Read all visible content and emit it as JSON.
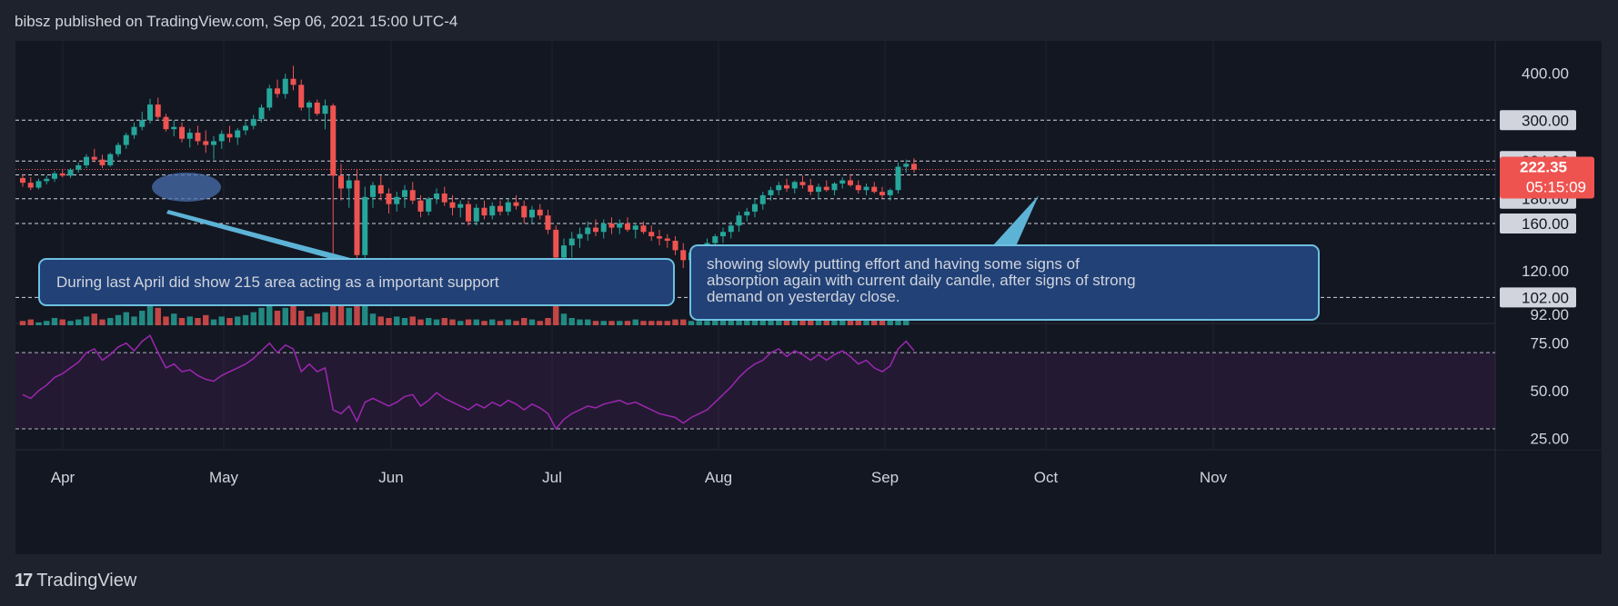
{
  "header": {
    "text": "bibsz published on TradingView.com, Sep 06, 2021 15:00 UTC-4"
  },
  "footer": {
    "brand": "TradingView",
    "logo_glyph": "17"
  },
  "colors": {
    "up": "#26a69a",
    "down": "#ef5350",
    "rsi": "#9c27b0",
    "bg": "#131722",
    "panel": "#1e222d"
  },
  "chart_data": [
    {
      "type": "candlestick",
      "scale": "log",
      "ylim": [
        90,
        460
      ],
      "x_labels": [
        "Apr",
        "May",
        "Jun",
        "Jul",
        "Aug",
        "Sep",
        "Oct",
        "Nov"
      ],
      "y_ticks": [
        {
          "label": "400.00",
          "value": 400,
          "boxed": false
        },
        {
          "label": "300.00",
          "value": 300,
          "boxed": true,
          "style": "light"
        },
        {
          "label": "234.00",
          "value": 234,
          "boxed": true,
          "style": "light"
        },
        {
          "label": "214.98",
          "value": 214.98,
          "boxed": true,
          "style": "light"
        },
        {
          "label": "186.00",
          "value": 186,
          "boxed": true,
          "style": "light"
        },
        {
          "label": "160.00",
          "value": 160,
          "boxed": true,
          "style": "light"
        },
        {
          "label": "120.00",
          "value": 120,
          "boxed": false
        },
        {
          "label": "102.00",
          "value": 102,
          "boxed": true,
          "style": "light"
        },
        {
          "label": "92.00",
          "value": 92,
          "boxed": false
        }
      ],
      "last_price": {
        "label": "222.35",
        "countdown": "05:15:09",
        "value": 222.35
      },
      "horizontal_levels": [
        300,
        234,
        222.35,
        214.98,
        186,
        160,
        102
      ],
      "candles": [
        [
          211,
          216,
          200,
          205
        ],
        [
          205,
          212,
          196,
          199
        ],
        [
          199,
          210,
          197,
          207
        ],
        [
          207,
          214,
          203,
          210
        ],
        [
          210,
          220,
          206,
          217
        ],
        [
          217,
          223,
          212,
          214
        ],
        [
          214,
          224,
          211,
          222
        ],
        [
          222,
          232,
          218,
          228
        ],
        [
          228,
          244,
          224,
          240
        ],
        [
          240,
          252,
          232,
          236
        ],
        [
          236,
          243,
          224,
          228
        ],
        [
          228,
          246,
          226,
          244
        ],
        [
          244,
          262,
          240,
          258
        ],
        [
          258,
          278,
          252,
          274
        ],
        [
          274,
          296,
          268,
          288
        ],
        [
          288,
          316,
          282,
          300
        ],
        [
          300,
          342,
          294,
          330
        ],
        [
          330,
          344,
          302,
          306
        ],
        [
          306,
          312,
          280,
          284
        ],
        [
          284,
          300,
          272,
          288
        ],
        [
          288,
          296,
          262,
          268
        ],
        [
          268,
          285,
          254,
          278
        ],
        [
          278,
          290,
          258,
          264
        ],
        [
          264,
          282,
          246,
          258
        ],
        [
          258,
          272,
          236,
          264
        ],
        [
          264,
          282,
          252,
          276
        ],
        [
          276,
          290,
          262,
          270
        ],
        [
          270,
          286,
          258,
          282
        ],
        [
          282,
          298,
          274,
          290
        ],
        [
          290,
          310,
          284,
          302
        ],
        [
          302,
          330,
          296,
          324
        ],
        [
          324,
          372,
          318,
          364
        ],
        [
          364,
          384,
          344,
          352
        ],
        [
          352,
          398,
          342,
          386
        ],
        [
          386,
          418,
          360,
          372
        ],
        [
          372,
          384,
          318,
          324
        ],
        [
          324,
          338,
          300,
          334
        ],
        [
          334,
          340,
          308,
          312
        ],
        [
          312,
          340,
          284,
          328
        ],
        [
          328,
          332,
          128,
          214
        ],
        [
          214,
          230,
          184,
          198
        ],
        [
          198,
          214,
          176,
          208
        ],
        [
          208,
          222,
          118,
          132
        ],
        [
          132,
          200,
          122,
          188
        ],
        [
          188,
          206,
          176,
          202
        ],
        [
          202,
          214,
          184,
          192
        ],
        [
          192,
          198,
          170,
          180
        ],
        [
          180,
          194,
          172,
          188
        ],
        [
          188,
          202,
          176,
          196
        ],
        [
          196,
          206,
          180,
          184
        ],
        [
          184,
          190,
          166,
          172
        ],
        [
          172,
          188,
          168,
          186
        ],
        [
          186,
          198,
          180,
          192
        ],
        [
          192,
          200,
          178,
          182
        ],
        [
          182,
          190,
          168,
          176
        ],
        [
          176,
          184,
          166,
          180
        ],
        [
          180,
          184,
          158,
          162
        ],
        [
          162,
          180,
          158,
          176
        ],
        [
          176,
          184,
          164,
          168
        ],
        [
          168,
          182,
          164,
          178
        ],
        [
          178,
          184,
          168,
          172
        ],
        [
          172,
          186,
          168,
          182
        ],
        [
          182,
          190,
          174,
          178
        ],
        [
          178,
          184,
          160,
          166
        ],
        [
          166,
          178,
          160,
          174
        ],
        [
          174,
          180,
          164,
          168
        ],
        [
          168,
          174,
          150,
          154
        ],
        [
          154,
          158,
          118,
          130
        ],
        [
          130,
          146,
          118,
          140
        ],
        [
          140,
          152,
          130,
          146
        ],
        [
          146,
          156,
          138,
          150
        ],
        [
          150,
          162,
          144,
          156
        ],
        [
          156,
          164,
          148,
          152
        ],
        [
          152,
          164,
          146,
          160
        ],
        [
          160,
          166,
          150,
          156
        ],
        [
          156,
          164,
          150,
          160
        ],
        [
          160,
          166,
          152,
          154
        ],
        [
          154,
          160,
          146,
          158
        ],
        [
          158,
          162,
          150,
          152
        ],
        [
          152,
          158,
          144,
          148
        ],
        [
          148,
          154,
          140,
          146
        ],
        [
          146,
          150,
          138,
          144
        ],
        [
          144,
          148,
          132,
          136
        ],
        [
          136,
          142,
          122,
          128
        ],
        [
          128,
          138,
          122,
          134
        ],
        [
          134,
          140,
          126,
          138
        ],
        [
          138,
          146,
          132,
          142
        ],
        [
          142,
          150,
          136,
          148
        ],
        [
          148,
          156,
          142,
          152
        ],
        [
          152,
          162,
          146,
          158
        ],
        [
          158,
          172,
          152,
          168
        ],
        [
          168,
          176,
          162,
          172
        ],
        [
          172,
          186,
          166,
          180
        ],
        [
          180,
          194,
          174,
          190
        ],
        [
          190,
          200,
          184,
          196
        ],
        [
          196,
          206,
          190,
          202
        ],
        [
          202,
          210,
          194,
          198
        ],
        [
          198,
          208,
          192,
          206
        ],
        [
          206,
          214,
          198,
          202
        ],
        [
          202,
          210,
          190,
          194
        ],
        [
          194,
          204,
          186,
          200
        ],
        [
          200,
          208,
          194,
          196
        ],
        [
          196,
          206,
          190,
          204
        ],
        [
          204,
          212,
          198,
          208
        ],
        [
          208,
          216,
          200,
          202
        ],
        [
          202,
          208,
          192,
          196
        ],
        [
          196,
          204,
          190,
          200
        ],
        [
          200,
          206,
          192,
          194
        ],
        [
          194,
          200,
          186,
          190
        ],
        [
          190,
          198,
          184,
          196
        ],
        [
          196,
          232,
          192,
          226
        ],
        [
          226,
          236,
          218,
          230
        ],
        [
          230,
          238,
          218,
          222
        ]
      ]
    },
    {
      "type": "bar",
      "name": "volume",
      "values": [
        3,
        4,
        2,
        3,
        5,
        4,
        3,
        4,
        6,
        8,
        4,
        5,
        7,
        9,
        6,
        10,
        16,
        12,
        6,
        8,
        5,
        6,
        5,
        7,
        4,
        6,
        5,
        6,
        7,
        9,
        12,
        18,
        10,
        12,
        14,
        10,
        6,
        8,
        9,
        30,
        14,
        12,
        22,
        16,
        8,
        6,
        5,
        6,
        5,
        6,
        4,
        5,
        4,
        5,
        4,
        3,
        4,
        4,
        3,
        4,
        3,
        4,
        3,
        5,
        4,
        3,
        5,
        18,
        8,
        5,
        4,
        4,
        3,
        3,
        3,
        3,
        3,
        4,
        3,
        3,
        3,
        3,
        4,
        4,
        3,
        3,
        3,
        4,
        4,
        4,
        5,
        4,
        5,
        5,
        5,
        4,
        5,
        4,
        4,
        4,
        4,
        4,
        4,
        4,
        4,
        4,
        4,
        4,
        4,
        14,
        8,
        6
      ]
    },
    {
      "type": "line",
      "name": "RSI",
      "ylim": [
        20,
        82
      ],
      "y_ticks": [
        "75.00",
        "50.00",
        "25.00"
      ],
      "band": [
        30,
        70
      ],
      "values": [
        48,
        46,
        50,
        53,
        57,
        59,
        62,
        65,
        70,
        72,
        66,
        69,
        73,
        75,
        71,
        76,
        79,
        70,
        62,
        64,
        60,
        61,
        58,
        56,
        55,
        58,
        60,
        62,
        64,
        67,
        71,
        75,
        70,
        74,
        72,
        60,
        64,
        60,
        62,
        40,
        38,
        42,
        34,
        44,
        46,
        44,
        42,
        44,
        47,
        48,
        42,
        45,
        49,
        46,
        44,
        42,
        40,
        43,
        41,
        44,
        42,
        45,
        43,
        40,
        43,
        41,
        38,
        30,
        35,
        38,
        40,
        42,
        41,
        43,
        44,
        45,
        43,
        44,
        42,
        40,
        38,
        37,
        36,
        33,
        36,
        38,
        40,
        44,
        48,
        52,
        57,
        61,
        64,
        66,
        70,
        72,
        68,
        71,
        69,
        66,
        69,
        66,
        69,
        71,
        68,
        64,
        66,
        62,
        60,
        63,
        72,
        76,
        71
      ]
    }
  ],
  "annotations": {
    "left_box": "During last April did show 215 area acting as a important support",
    "right_box": "showing slowly putting effort and having some signs of absorption again with current daily candle, after signs of strong demand on yesterday close."
  }
}
